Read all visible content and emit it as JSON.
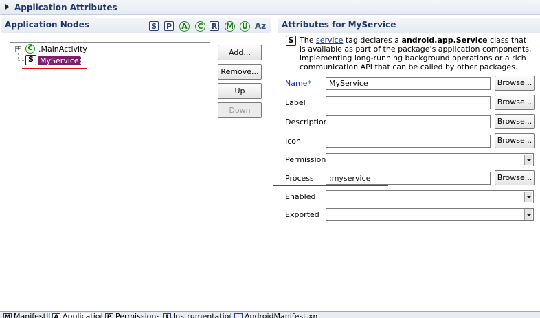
{
  "section": {
    "title": "Application Attributes"
  },
  "left_panel": {
    "title": "Application Nodes",
    "toolbar": [
      "S",
      "P",
      "A",
      "C",
      "R",
      "M",
      "U",
      "Az"
    ],
    "tree": [
      {
        "label": ".MainActivity",
        "icon": "C"
      },
      {
        "label": "MyService",
        "icon": "S",
        "selected": true
      }
    ],
    "buttons": {
      "add": "Add...",
      "remove": "Remove...",
      "up": "Up",
      "down": "Down"
    }
  },
  "right_panel": {
    "title": "Attributes for MyService",
    "icon": "S",
    "description": {
      "before": "The ",
      "link": "service",
      "middle": " tag declares a ",
      "bold": "android.app.Service",
      "after": " class that is available as part of the package's application components, implementing long-running background operations or a rich communication API that can be called by other packages."
    },
    "fields": {
      "name": {
        "label": "Name*",
        "value": "MyService"
      },
      "label": {
        "label": "Label",
        "value": ""
      },
      "description": {
        "label": "Description",
        "value": ""
      },
      "icon": {
        "label": "Icon",
        "value": ""
      },
      "permission": {
        "label": "Permission",
        "value": ""
      },
      "process": {
        "label": "Process",
        "value": ":myservice"
      },
      "enabled": {
        "label": "Enabled",
        "value": ""
      },
      "exported": {
        "label": "Exported",
        "value": ""
      }
    },
    "browse_label": "Browse..."
  },
  "tabs": [
    {
      "label": "Manifest",
      "icon": "M"
    },
    {
      "label": "Application",
      "icon": "A",
      "active": true
    },
    {
      "label": "Permissions",
      "icon": "P"
    },
    {
      "label": "Instrumentation",
      "icon": "I"
    },
    {
      "label": "AndroidManifest.xml",
      "icon": ""
    }
  ],
  "colors": {
    "header_text": "#1f3763",
    "selection": "#7d1f6b",
    "annotation_red": "#e01010",
    "link": "#1a3aa0"
  }
}
